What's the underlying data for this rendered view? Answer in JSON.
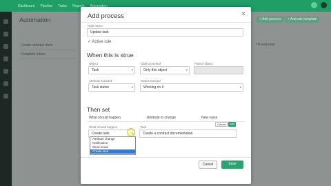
{
  "app": {
    "nav": [
      "Dashboard",
      "Pipeline",
      "Tasks",
      "Reports",
      "Automation"
    ],
    "page_title": "Automation",
    "bg_buttons": [
      "+ Add process",
      "+ Activate template"
    ],
    "bg_rows": [
      "Create contract docs",
      "Complete Inbox"
    ],
    "bg_right": "Hi everyone"
  },
  "modal": {
    "title": "Add process",
    "close": "×",
    "rule_name_label": "Rule name",
    "rule_name_value": "Update task",
    "active_rule": "Active rule",
    "when_title": "When this is strue",
    "object_label": "Object",
    "object_value": "Task",
    "object_tracked_label": "Object tracked",
    "object_tracked_value": "Only this object",
    "parent_object_label": "Parent object",
    "attribute_tracked_label": "Attribute tracked",
    "attribute_tracked_value": "Task status",
    "status_tracked_label": "Status tracked",
    "status_tracked_value": "Working on it",
    "then_title": "Then set",
    "col_what": "What should happen",
    "col_attribute": "Attribute to change",
    "col_new_value": "New value",
    "what_label": "What should happen",
    "what_value": "Create task",
    "task_label": "Task",
    "task_value": "Create a contract documentation",
    "dropdown_options": [
      "Attribute change",
      "Notification",
      "Send email",
      "Create task"
    ],
    "dropdown_selected": "Create task",
    "cancel_small": "Cancel",
    "add_small": "Add",
    "cancel": "Cancel",
    "save": "Save"
  },
  "colors": {
    "accent": "#2aa56e",
    "topbar": "#1f9e66",
    "selected": "#2d7be0"
  },
  "icons": [
    "close-icon",
    "check-icon",
    "chevron-down-icon"
  ]
}
